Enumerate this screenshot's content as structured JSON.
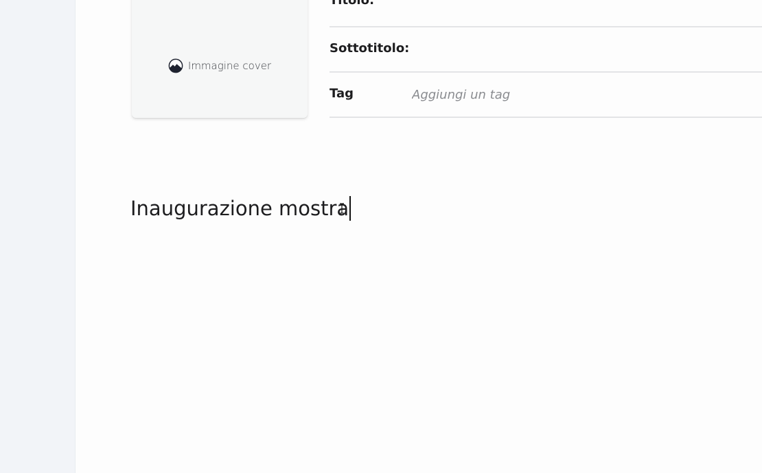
{
  "cover": {
    "label": "Immagine cover",
    "icon": "mountain-image-icon"
  },
  "fields": {
    "titolo_label": "Titolo:",
    "sottotitolo_label": "Sottotitolo:",
    "tag_label": "Tag",
    "tag_placeholder": "Aggiungi un tag"
  },
  "editor": {
    "text": "Inaugurazione mostra"
  },
  "colors": {
    "rail": "#f2f4f8",
    "background": "#fdfdfd",
    "divider": "#e3e4e6",
    "placeholder": "#8a8c90"
  }
}
